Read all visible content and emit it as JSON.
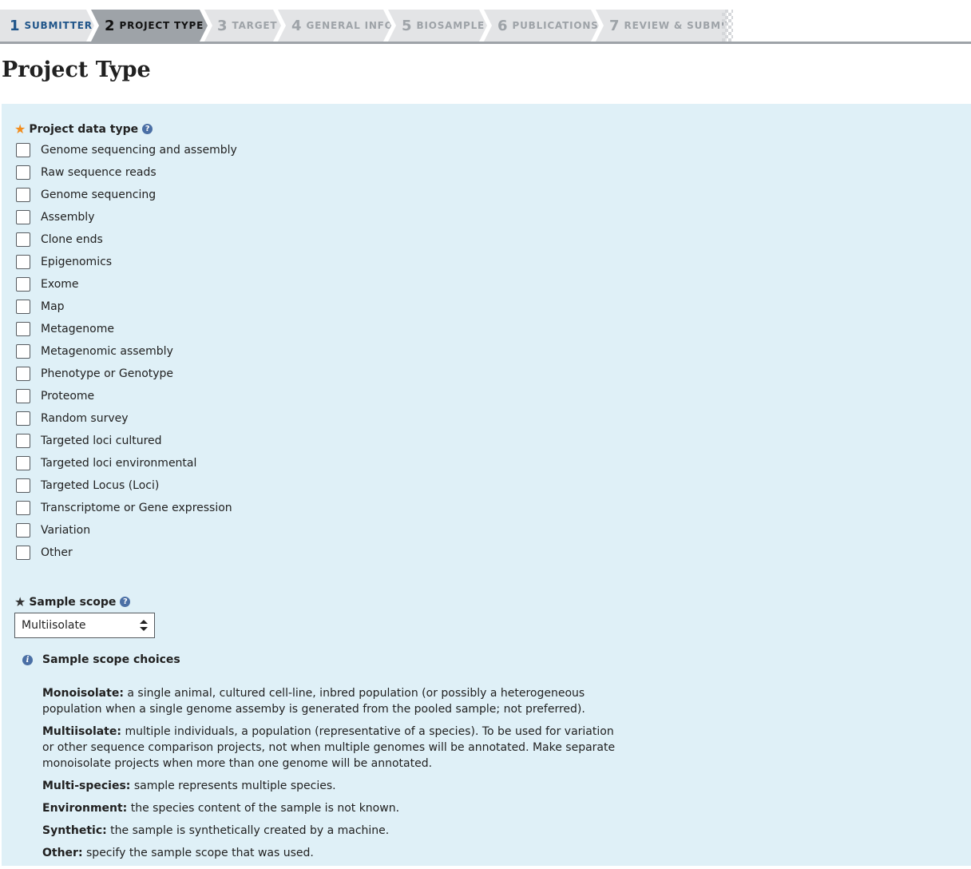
{
  "wizard": {
    "steps": [
      {
        "num": "1",
        "label": "SUBMITTER",
        "state": "done"
      },
      {
        "num": "2",
        "label": "PROJECT TYPE",
        "state": "active"
      },
      {
        "num": "3",
        "label": "TARGET",
        "state": "pending"
      },
      {
        "num": "4",
        "label": "GENERAL INFO",
        "state": "pending"
      },
      {
        "num": "5",
        "label": "BIOSAMPLE",
        "state": "pending"
      },
      {
        "num": "6",
        "label": "PUBLICATIONS",
        "state": "pending"
      },
      {
        "num": "7",
        "label": "REVIEW & SUBMIT",
        "state": "pending"
      }
    ]
  },
  "page": {
    "title": "Project Type"
  },
  "project_data_type": {
    "label": "Project data type",
    "help_icon": "question-circle-icon",
    "options": [
      {
        "label": "Genome sequencing and assembly",
        "checked": false
      },
      {
        "label": "Raw sequence reads",
        "checked": false
      },
      {
        "label": "Genome sequencing",
        "checked": false
      },
      {
        "label": "Assembly",
        "checked": false
      },
      {
        "label": "Clone ends",
        "checked": false
      },
      {
        "label": "Epigenomics",
        "checked": false
      },
      {
        "label": "Exome",
        "checked": false
      },
      {
        "label": "Map",
        "checked": false
      },
      {
        "label": "Metagenome",
        "checked": false
      },
      {
        "label": "Metagenomic assembly",
        "checked": false
      },
      {
        "label": "Phenotype or Genotype",
        "checked": false
      },
      {
        "label": "Proteome",
        "checked": false
      },
      {
        "label": "Random survey",
        "checked": false
      },
      {
        "label": "Targeted loci cultured",
        "checked": false
      },
      {
        "label": "Targeted loci environmental",
        "checked": false
      },
      {
        "label": "Targeted Locus (Loci)",
        "checked": false
      },
      {
        "label": "Transcriptome or Gene expression",
        "checked": false
      },
      {
        "label": "Variation",
        "checked": false
      },
      {
        "label": "Other",
        "checked": false
      }
    ]
  },
  "sample_scope": {
    "label": "Sample scope",
    "selected": "Multiisolate",
    "info_title": "Sample scope choices",
    "choices": [
      {
        "term": "Monoisolate:",
        "desc": "a single animal, cultured cell-line, inbred population (or possibly a heterogeneous population when a single genome assemby is generated from the pooled sample; not preferred)."
      },
      {
        "term": "Multiisolate:",
        "desc": "multiple individuals, a population (representative of a species). To be used for variation or other sequence comparison projects, not when multiple genomes will be annotated. Make separate monoisolate projects when more than one genome will be annotated."
      },
      {
        "term": "Multi-species:",
        "desc": "sample represents multiple species."
      },
      {
        "term": "Environment:",
        "desc": "the species content of the sample is not known."
      },
      {
        "term": "Synthetic:",
        "desc": "the sample is synthetically created by a machine."
      },
      {
        "term": "Other:",
        "desc": "specify the sample scope that was used."
      }
    ]
  },
  "colors": {
    "panel_bg": "#dff0f7",
    "step_done": "#20558a",
    "step_active_bg": "#9ea3a8",
    "required_star": "#f28c1b",
    "help_icon": "#4a6fa5"
  }
}
